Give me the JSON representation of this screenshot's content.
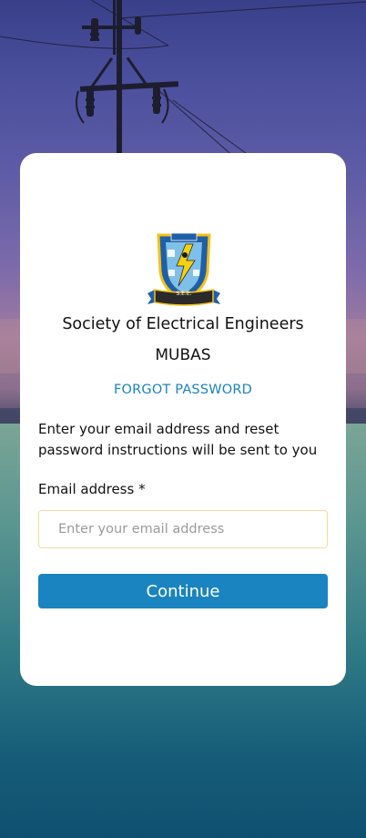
{
  "colors": {
    "accent": "#1a84c0",
    "card_background": "#ffffff",
    "input_border": "#f0dca2"
  },
  "logo": {
    "icon": "society-emblem-icon",
    "ribbon_text": "S.E.E."
  },
  "header": {
    "org_name": "Society of Electrical Engineers",
    "org_sub": "MUBAS"
  },
  "page": {
    "heading": "FORGOT PASSWORD",
    "instructions": "Enter your email address and reset password instructions will be sent to you"
  },
  "form": {
    "email_label": "Email address *",
    "email_placeholder": "Enter your email address",
    "email_value": "",
    "submit_label": "Continue"
  }
}
